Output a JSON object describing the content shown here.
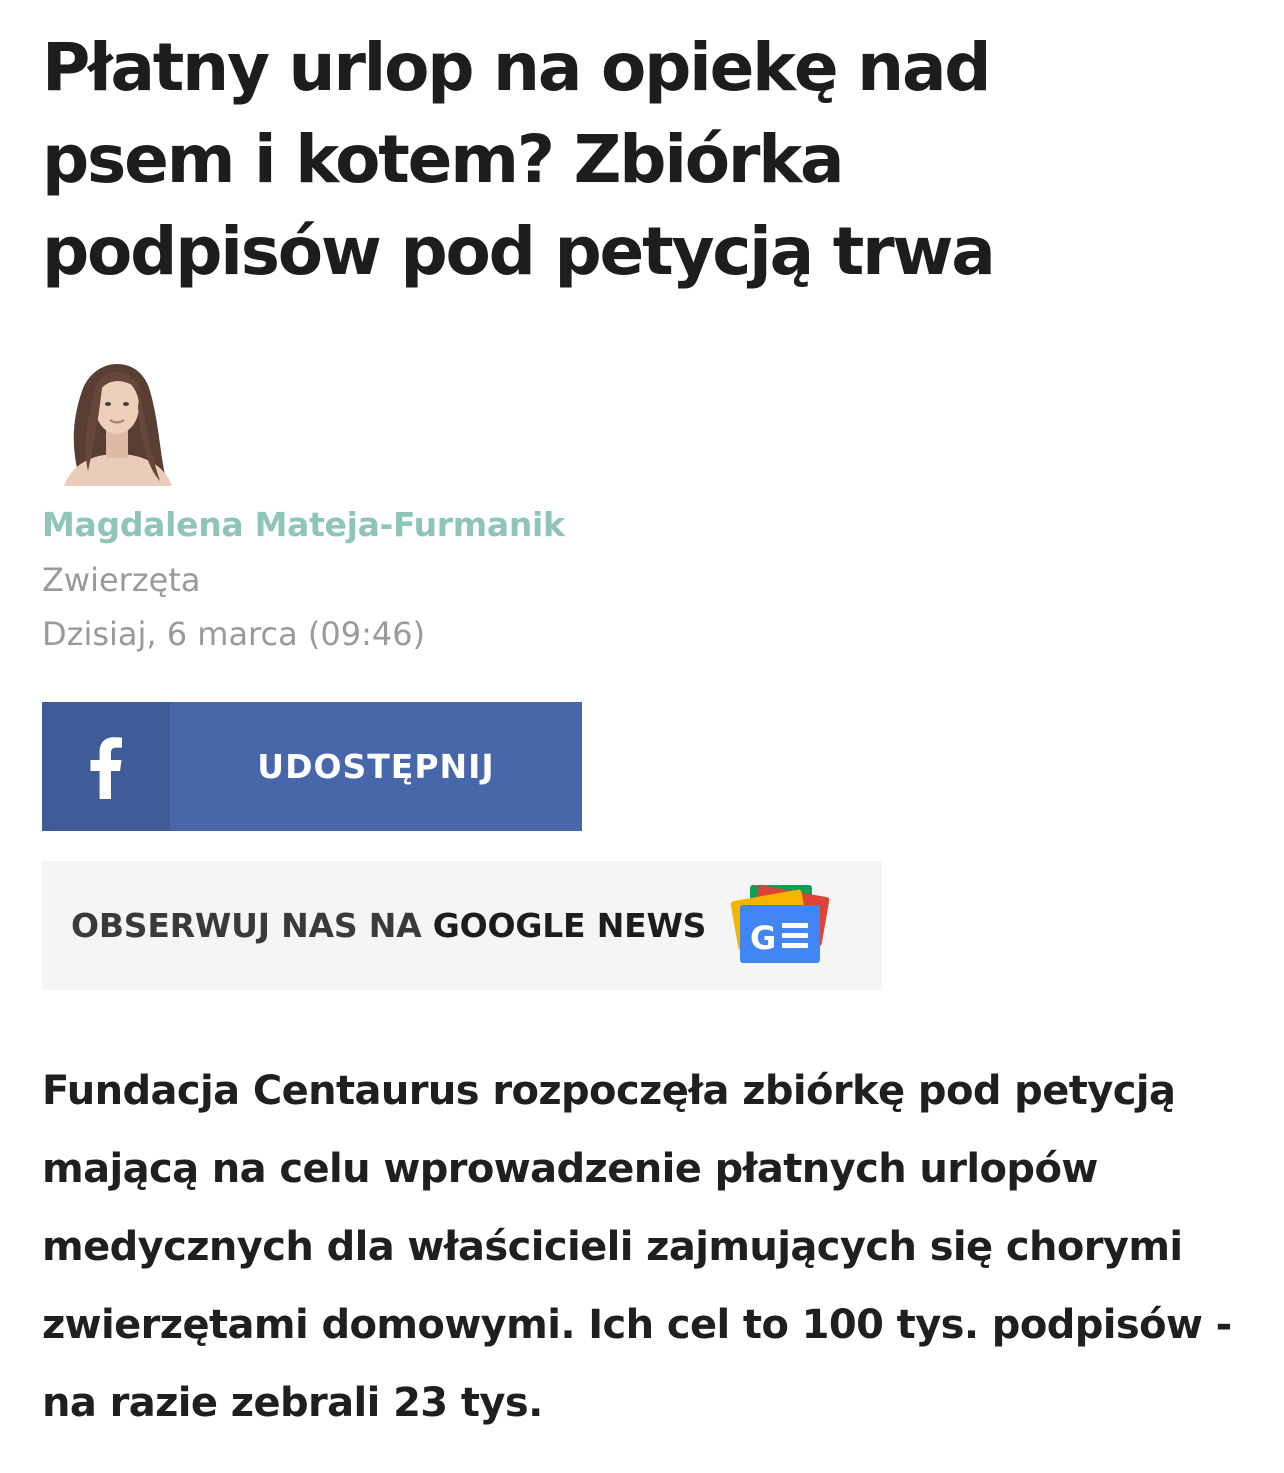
{
  "article": {
    "title": "Płatny urlop na opiekę nad psem i kotem? Zbiórka podpisów pod petycją trwa",
    "author": "Magdalena Mateja-Furmanik",
    "category": "Zwierzęta",
    "date": "Dzisiaj, 6 marca (09:46)",
    "lead": "Fundacja Centaurus rozpoczęła zbiórkę pod petycją mającą na celu wprowadzenie płatnych urlopów medycznych dla właścicieli zajmujących się chorymi zwierzętami domowymi. Ich cel to 100 tys. podpisów - na razie zebrali 23 tys."
  },
  "share": {
    "facebook_label": "UDOSTĘPNIJ",
    "icon": "facebook-icon",
    "color": "#4767aa",
    "icon_bg": "#3f5c99"
  },
  "google_news": {
    "prefix": "OBSERWUJ NAS NA ",
    "brand": "GOOGLE NEWS",
    "icon": "google-news-icon"
  },
  "colors": {
    "author": "#8ec5b8",
    "meta": "#9a9a9a"
  }
}
